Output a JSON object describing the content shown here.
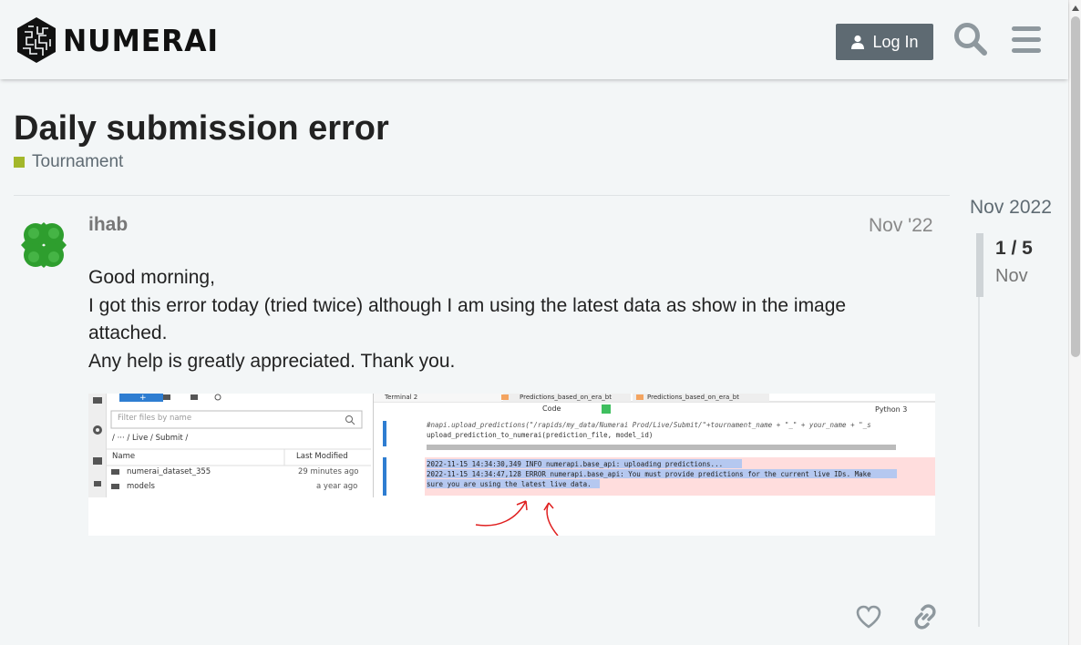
{
  "header": {
    "logo_text": "NUMERAI",
    "login_label": "Log In"
  },
  "topic": {
    "title": "Daily submission error",
    "category": "Tournament",
    "category_color": "#a3b72a"
  },
  "post": {
    "username": "ihab",
    "date": "Nov '22",
    "body": [
      "Good morning,",
      "I got this error today (tried twice) although I am using the latest data as show in the image attached.",
      "Any help is greatly appreciated. Thank you."
    ]
  },
  "screenshot": {
    "filter_placeholder": "Filter files by name",
    "path": "/ ··· / Live / Submit /",
    "col_name": "Name",
    "col_modified": "Last Modified",
    "files": [
      {
        "name": "numerai_dataset_355",
        "modified": "29 minutes ago"
      },
      {
        "name": "models",
        "modified": "a year ago"
      }
    ],
    "tabs": [
      "Terminal 2",
      "Predictions_based_on_era_bt",
      "Predictions_based_on_era_bt"
    ],
    "cell_type": "Code",
    "kernel": "Python 3",
    "code_line1": "#napi.upload_predictions(\"/rapids/my_data/Numerai Prod/Live/Submit/\"+tournament_name + \"_\" + your_name  + \"_s",
    "code_line2": "upload_prediction_to_numerai(prediction_file, model_id)",
    "log_line1": "2022-11-15 14:34:30,349 INFO numerapi.base_api: uploading predictions...",
    "log_line2": "2022-11-15 14:34:47,128 ERROR numerapi.base_api: You must provide predictions for the current live IDs. Make",
    "log_line3": "sure you are using the latest live data."
  },
  "timeline": {
    "top_date": "Nov 2022",
    "count": "1 / 5",
    "current_date": "Nov"
  },
  "colors": {
    "accent": "#5e6a72",
    "background": "#f3f6f7"
  }
}
